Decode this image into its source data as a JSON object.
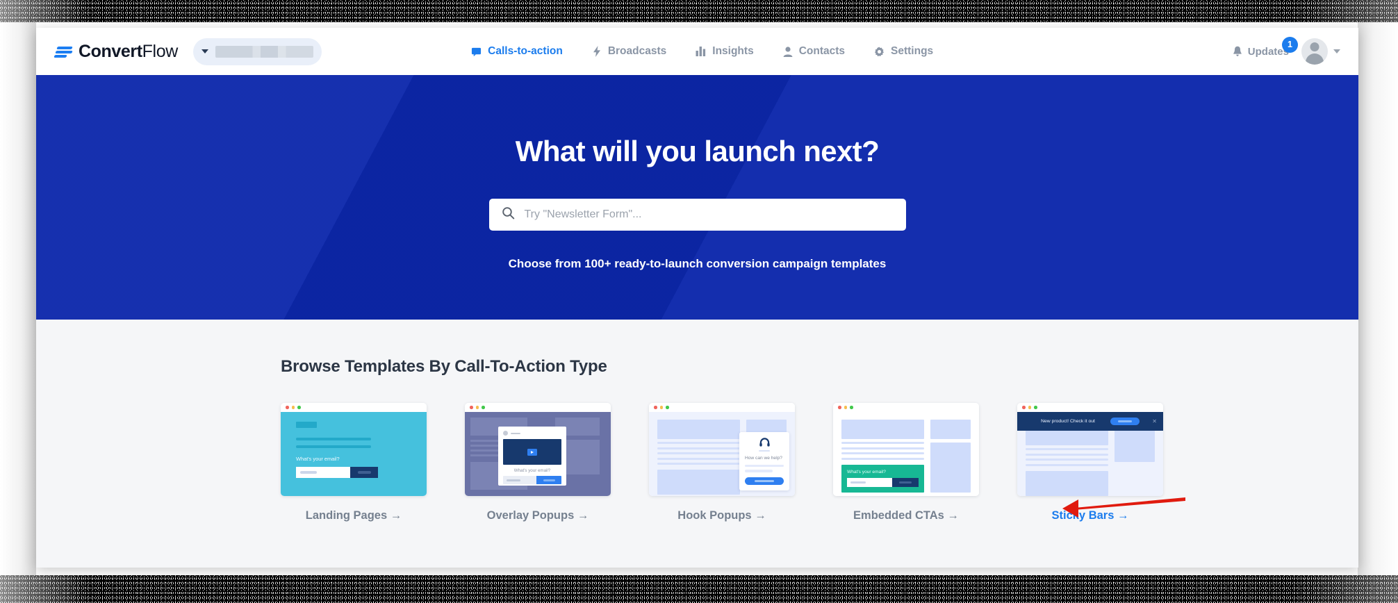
{
  "brand": {
    "name_bold": "Convert",
    "name_light": "Flow",
    "logo_icon": "convertflow-wing-icon"
  },
  "account_switcher": {
    "redacted": true,
    "caret_icon": "caret-down-icon"
  },
  "nav": {
    "items": [
      {
        "label": "Calls-to-action",
        "icon": "chat-bubble-icon",
        "active": true
      },
      {
        "label": "Broadcasts",
        "icon": "lightning-bolt-icon",
        "active": false
      },
      {
        "label": "Insights",
        "icon": "bar-chart-icon",
        "active": false
      },
      {
        "label": "Contacts",
        "icon": "person-icon",
        "active": false
      },
      {
        "label": "Settings",
        "icon": "gear-icon",
        "active": false
      }
    ],
    "updates": {
      "label": "Updates",
      "icon": "bell-icon",
      "badge_count": "1"
    },
    "avatar": {
      "icon": "user-avatar-icon",
      "caret_icon": "caret-down-icon"
    }
  },
  "hero": {
    "title": "What will you launch next?",
    "search": {
      "placeholder": "Try \"Newsletter Form\"...",
      "value": "",
      "icon": "search-icon"
    },
    "subtitle": "Choose from 100+ ready-to-launch conversion campaign templates",
    "background_color": "#0c27ab"
  },
  "templates_section": {
    "title": "Browse Templates By Call-To-Action Type",
    "cards": [
      {
        "label": "Landing Pages →",
        "highlighted": false,
        "preview": {
          "type": "landing-page",
          "form_label": "What's your email?",
          "accent_color": "#45c1dd"
        }
      },
      {
        "label": "Overlay Popups →",
        "highlighted": false,
        "preview": {
          "type": "overlay-popup",
          "form_label": "What's your email?",
          "accent_color": "#6a72a6"
        }
      },
      {
        "label": "Hook Popups →",
        "highlighted": false,
        "preview": {
          "type": "hook-popup",
          "hook_text": "How can we help?",
          "icon": "headset-icon",
          "accent_color": "#2f7ff0"
        }
      },
      {
        "label": "Embedded CTAs →",
        "highlighted": false,
        "preview": {
          "type": "embedded-cta",
          "form_label": "What's your email?",
          "accent_color": "#17b894"
        }
      },
      {
        "label": "Sticky Bars →",
        "highlighted": true,
        "preview": {
          "type": "sticky-bar",
          "bar_text": "New product!  Check it out",
          "close_icon": "close-x-icon",
          "accent_color": "#17396d"
        }
      }
    ]
  },
  "annotation": {
    "type": "red-arrow",
    "points_to": "Sticky Bars →",
    "color": "#e01b0f"
  }
}
